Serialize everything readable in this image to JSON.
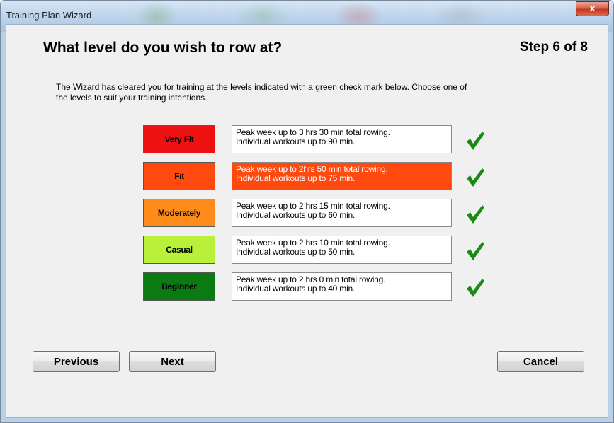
{
  "window": {
    "title": "Training Plan Wizard",
    "close_label": "x"
  },
  "wizard": {
    "heading": "What level do you wish to row at?",
    "step": "Step 6 of 8",
    "intro_line1": "The Wizard has cleared you for training at the levels indicated with a green check mark below.  Choose one of",
    "intro_line2": "the levels to suit your training intentions."
  },
  "levels": [
    {
      "label": "Very Fit",
      "color": "#ee1111",
      "line1": "Peak week up to 3 hrs 30 min total rowing.",
      "line2": "Individual workouts up to 90 min.",
      "selected": false,
      "cleared": true
    },
    {
      "label": "Fit",
      "color": "#ff4a0f",
      "line1": "Peak week up to 2hrs 50 min total rowing.",
      "line2": "Individual workouts up to 75 min.",
      "selected": true,
      "cleared": true
    },
    {
      "label": "Moderately",
      "color": "#ff8c1a",
      "line1": "Peak week up to 2 hrs 15 min total rowing.",
      "line2": "Individual workouts up to 60 min.",
      "selected": false,
      "cleared": true
    },
    {
      "label": "Casual",
      "color": "#b8f03a",
      "line1": "Peak week up to 2 hrs 10 min total rowing.",
      "line2": "Individual workouts up to 50 min.",
      "selected": false,
      "cleared": true
    },
    {
      "label": "Beginner",
      "color": "#0c7a12",
      "line1": "Peak week up to 2 hrs 0 min total rowing.",
      "line2": "Individual workouts up to 40 min.",
      "selected": false,
      "cleared": true
    }
  ],
  "colors": {
    "check": "#1a8a12",
    "selected_desc_bg": "#ff4a0f"
  },
  "buttons": {
    "previous": "Previous",
    "next": "Next",
    "cancel": "Cancel"
  }
}
